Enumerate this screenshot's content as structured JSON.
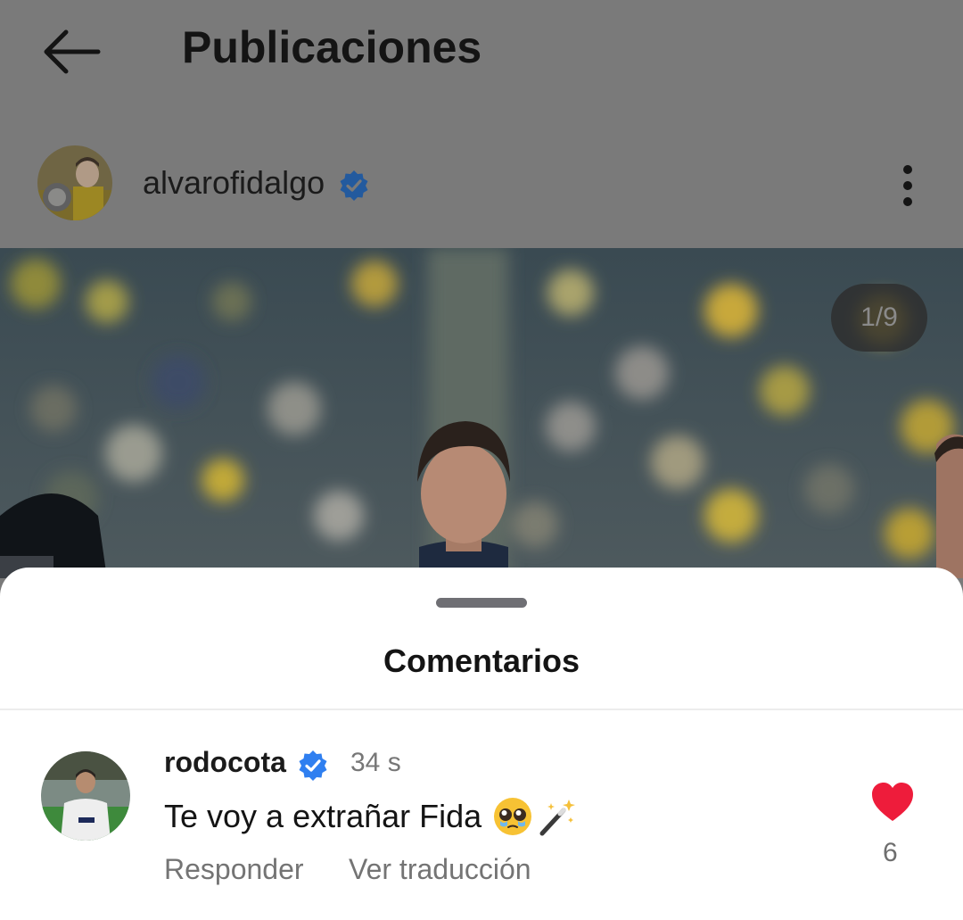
{
  "header": {
    "title": "Publicaciones",
    "back_icon": "arrow-left-icon"
  },
  "post": {
    "username": "alvarofidalgo",
    "verified": true,
    "more_icon": "more-vertical-icon",
    "image_counter": "1/9"
  },
  "comments_sheet": {
    "title": "Comentarios",
    "comments": [
      {
        "username": "rodocota",
        "verified": true,
        "time": "34 s",
        "text": "Te voy a extrañar Fida",
        "emojis": [
          "pleading-face-emoji",
          "magic-wand-emoji"
        ],
        "reply_label": "Responder",
        "translate_label": "Ver traducción",
        "like_count": "6"
      }
    ]
  },
  "colors": {
    "overlay": "#7a7a7a",
    "verified_blue": "#2f7ff0",
    "like_red": "#ee1c3b"
  }
}
